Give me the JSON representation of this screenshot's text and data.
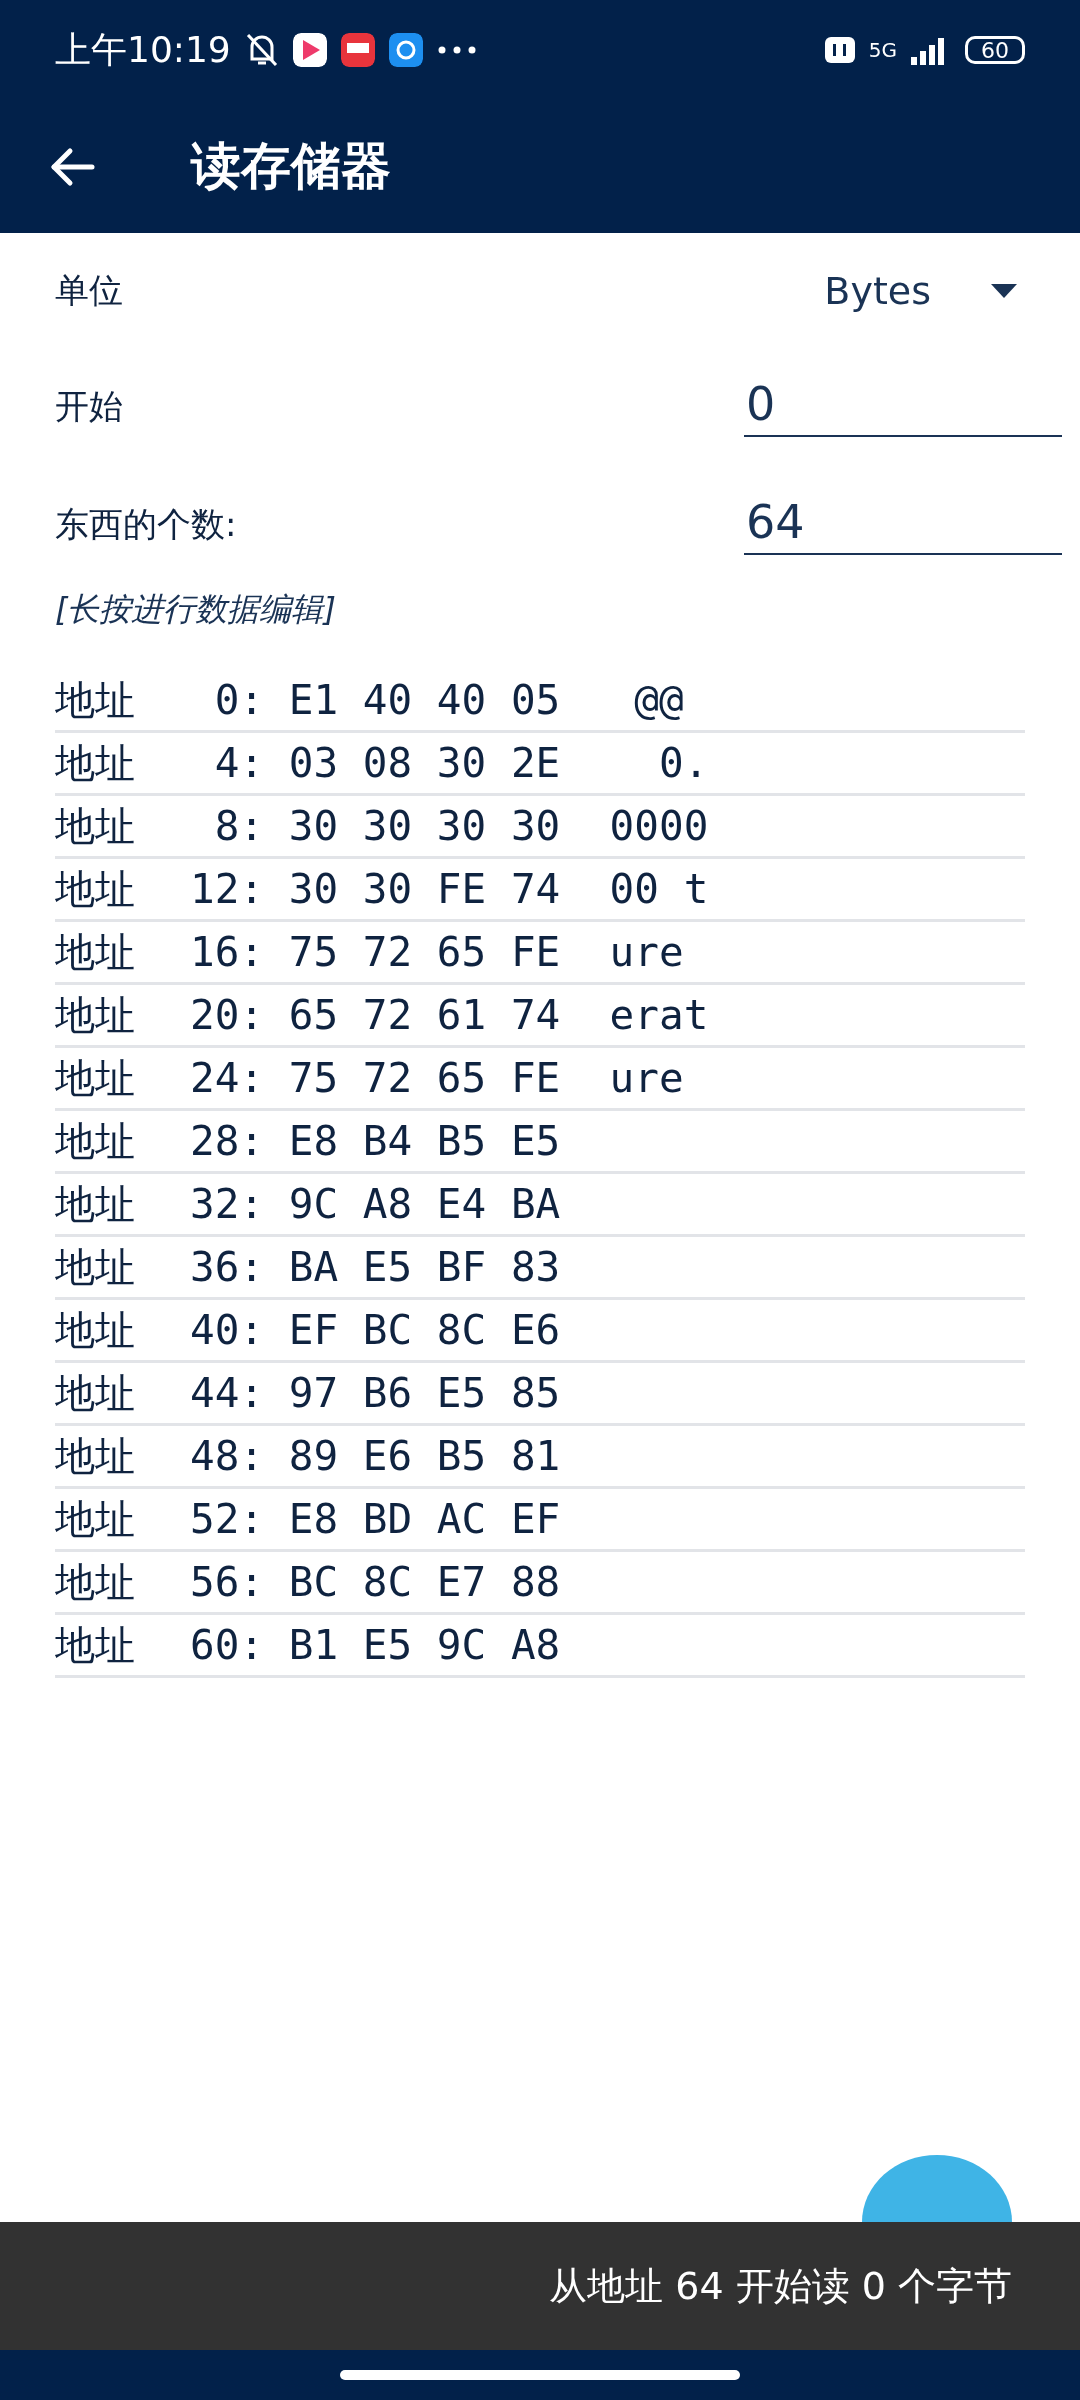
{
  "status_bar": {
    "time": "上午10:19",
    "network": "5G",
    "battery": "60"
  },
  "app_bar": {
    "title": "读存储器"
  },
  "form": {
    "unit_label": "单位",
    "unit_value": "Bytes",
    "start_label": "开始",
    "start_value": "0",
    "count_label": "东西的个数:",
    "count_value": "64",
    "hint": "[长按进行数据编辑]"
  },
  "rows": [
    {
      "label": "地址",
      "address": "0:",
      "bytes": "E1 40 40 05",
      "ascii": " @@"
    },
    {
      "label": "地址",
      "address": "4:",
      "bytes": "03 08 30 2E",
      "ascii": "  0."
    },
    {
      "label": "地址",
      "address": "8:",
      "bytes": "30 30 30 30",
      "ascii": "0000"
    },
    {
      "label": "地址",
      "address": "12:",
      "bytes": "30 30 FE 74",
      "ascii": "00 t"
    },
    {
      "label": "地址",
      "address": "16:",
      "bytes": "75 72 65 FE",
      "ascii": "ure"
    },
    {
      "label": "地址",
      "address": "20:",
      "bytes": "65 72 61 74",
      "ascii": "erat"
    },
    {
      "label": "地址",
      "address": "24:",
      "bytes": "75 72 65 FE",
      "ascii": "ure"
    },
    {
      "label": "地址",
      "address": "28:",
      "bytes": "E8 B4 B5 E5"
    },
    {
      "label": "地址",
      "address": "32:",
      "bytes": "9C A8 E4 BA"
    },
    {
      "label": "地址",
      "address": "36:",
      "bytes": "BA E5 BF 83"
    },
    {
      "label": "地址",
      "address": "40:",
      "bytes": "EF BC 8C E6"
    },
    {
      "label": "地址",
      "address": "44:",
      "bytes": "97 B6 E5 85"
    },
    {
      "label": "地址",
      "address": "48:",
      "bytes": "89 E6 B5 81"
    },
    {
      "label": "地址",
      "address": "52:",
      "bytes": "E8 BD AC EF"
    },
    {
      "label": "地址",
      "address": "56:",
      "bytes": "BC 8C E7 88"
    },
    {
      "label": "地址",
      "address": "60:",
      "bytes": "B1 E5 9C A8"
    }
  ],
  "snackbar": {
    "message": "从地址 64 开始读 0 个字节"
  }
}
